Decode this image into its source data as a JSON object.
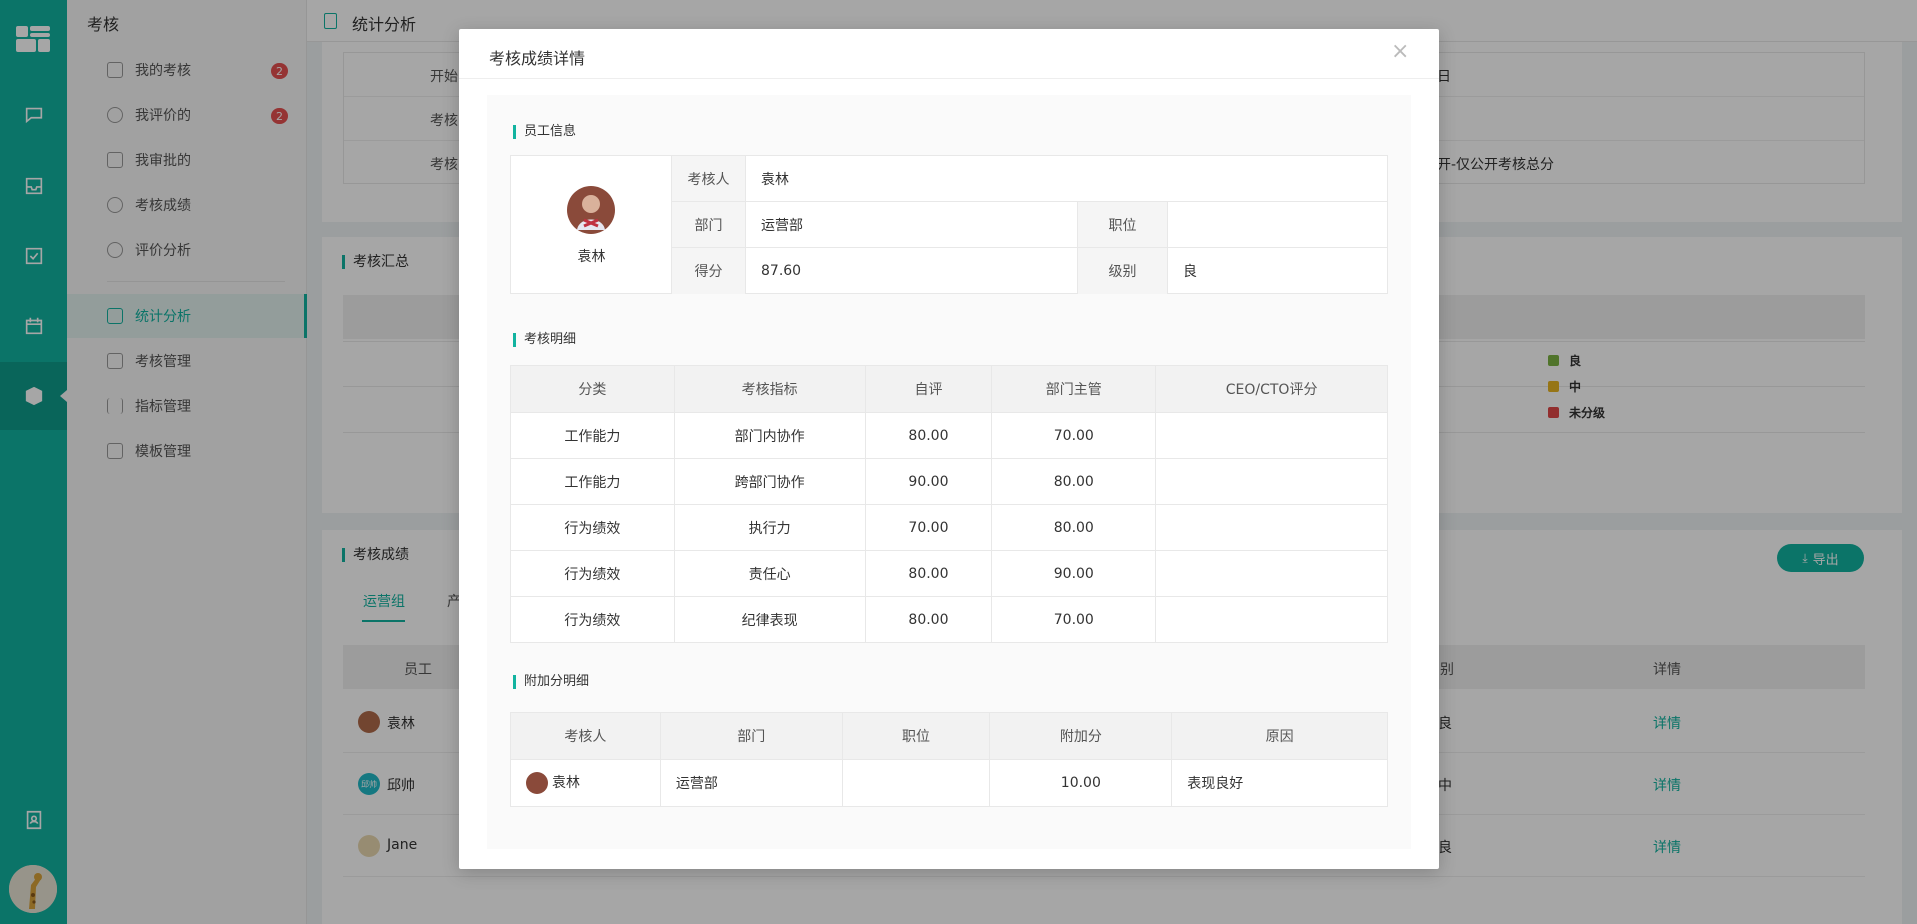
{
  "app": {
    "module_title": "考核"
  },
  "submenu": [
    {
      "label": "我的考核",
      "badge": "2"
    },
    {
      "label": "我评价的",
      "badge": "2"
    },
    {
      "label": "我审批的"
    },
    {
      "label": "考核成绩"
    },
    {
      "label": "评价分析"
    },
    {
      "label": "统计分析",
      "active": true
    },
    {
      "label": "考核管理"
    },
    {
      "label": "指标管理"
    },
    {
      "label": "模板管理"
    }
  ],
  "rail_icons": [
    "grid-logo-icon",
    "chat-icon",
    "inbox-icon",
    "check-square-icon",
    "calendar-icon",
    "cube-icon",
    "contacts-icon"
  ],
  "page": {
    "title": "统计分析"
  },
  "background": {
    "info_labels": [
      "开始",
      "考核",
      "考核"
    ],
    "info_values": [
      "日",
      "",
      "开-仅公开考核总分"
    ],
    "summary_title": "考核汇总",
    "legend": [
      {
        "label": "良",
        "color": "#7cb342"
      },
      {
        "label": "中",
        "color": "#e6b422"
      },
      {
        "label": "未分级",
        "color": "#e04848"
      }
    ],
    "scores_title": "考核成绩",
    "tabs": [
      "运营组",
      "产"
    ],
    "export_label": "导出",
    "col_employee": "员工",
    "col_level": "别",
    "col_detail": "详情",
    "rows": [
      {
        "name": "袁林",
        "level": "良",
        "detail": "详情"
      },
      {
        "name": "邱帅",
        "level": "中",
        "detail": "详情",
        "avatar_text": "邱帅"
      },
      {
        "name": "Jane",
        "level": "良",
        "detail": "详情"
      }
    ]
  },
  "modal": {
    "title": "考核成绩详情",
    "close": "×",
    "employee_section": "员工信息",
    "employee": {
      "name": "袁林",
      "labels": {
        "assessee": "考核人",
        "department": "部门",
        "position": "职位",
        "score": "得分",
        "level": "级别"
      },
      "values": {
        "assessee": "袁林",
        "department": "运营部",
        "position": "",
        "score": "87.60",
        "level": "良"
      }
    },
    "detail_section": "考核明细",
    "detail_headers": [
      "分类",
      "考核指标",
      "自评",
      "部门主管",
      "CEO/CTO评分"
    ],
    "detail_rows": [
      [
        "工作能力",
        "部门内协作",
        "80.00",
        "70.00",
        ""
      ],
      [
        "工作能力",
        "跨部门协作",
        "90.00",
        "80.00",
        ""
      ],
      [
        "行为绩效",
        "执行力",
        "70.00",
        "80.00",
        ""
      ],
      [
        "行为绩效",
        "责任心",
        "80.00",
        "90.00",
        ""
      ],
      [
        "行为绩效",
        "纪律表现",
        "80.00",
        "70.00",
        ""
      ]
    ],
    "bonus_section": "附加分明细",
    "bonus_headers": [
      "考核人",
      "部门",
      "职位",
      "附加分",
      "原因"
    ],
    "bonus_rows": [
      {
        "assessee": "袁林",
        "department": "运营部",
        "position": "",
        "bonus": "10.00",
        "reason": "表现良好"
      }
    ]
  }
}
